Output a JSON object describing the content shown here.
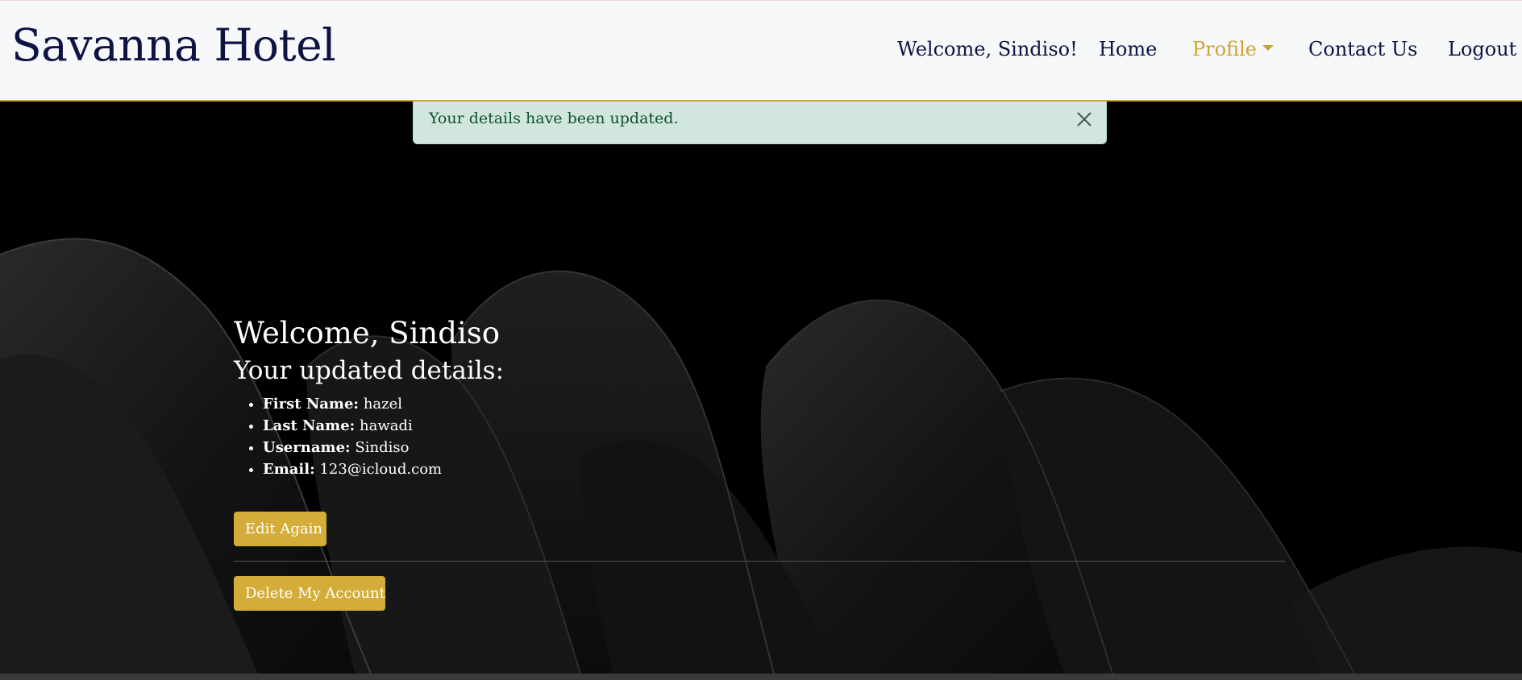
{
  "header": {
    "brand": "Savanna Hotel",
    "nav": {
      "welcome": "Welcome, Sindiso!",
      "home": "Home",
      "profile": "Profile",
      "contact": "Contact Us",
      "logout": "Logout"
    }
  },
  "alert": {
    "message": "Your details have been updated.",
    "close_icon": "close-icon"
  },
  "main": {
    "welcome": "Welcome, Sindiso",
    "details_heading": "Your updated details:",
    "details": [
      {
        "label": "First Name:",
        "value": "hazel"
      },
      {
        "label": "Last Name:",
        "value": "hawadi"
      },
      {
        "label": "Username:",
        "value": "Sindiso"
      },
      {
        "label": "Email:",
        "value": "123@icloud.com"
      }
    ],
    "edit_button": "Edit Again",
    "delete_button": "Delete My Account"
  },
  "colors": {
    "navy": "#0d1444",
    "gold": "#d4ad38",
    "alert_bg": "#d1e7dd",
    "alert_text": "#0f5132"
  }
}
